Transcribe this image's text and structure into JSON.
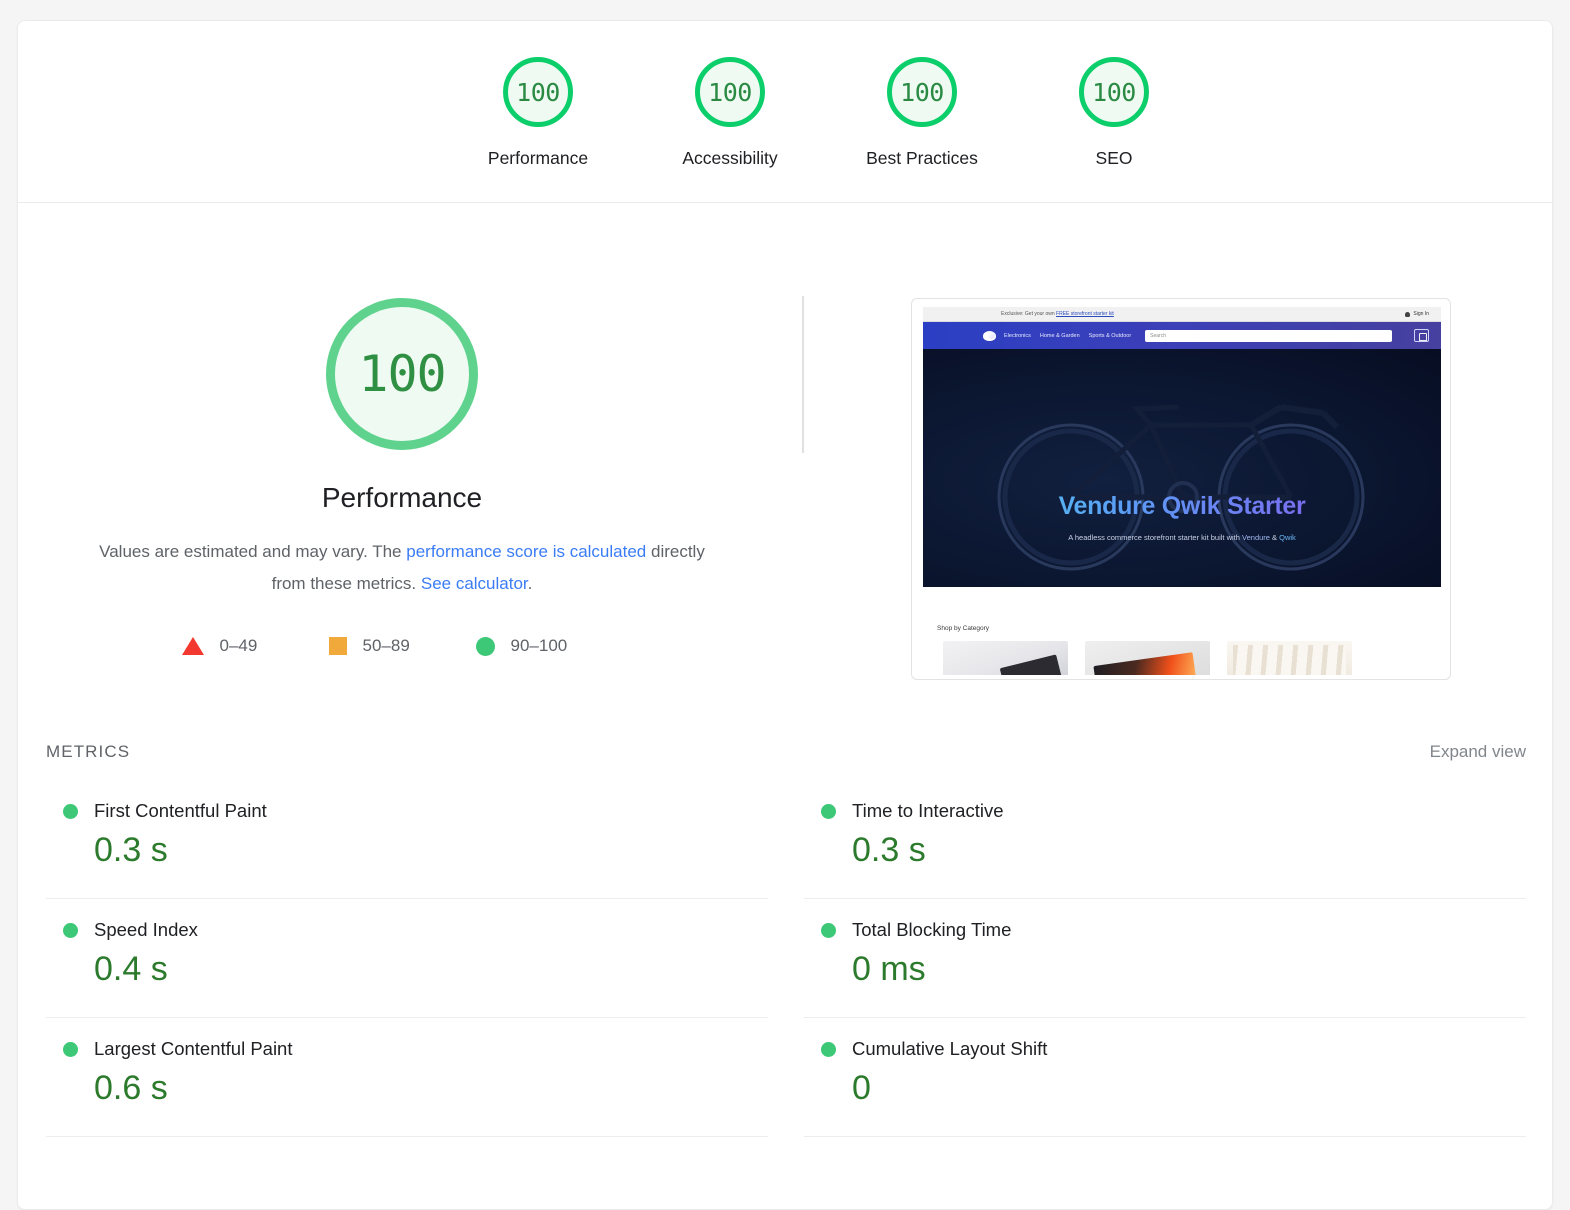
{
  "category_gauges": [
    {
      "score": "100",
      "label": "Performance"
    },
    {
      "score": "100",
      "label": "Accessibility"
    },
    {
      "score": "100",
      "label": "Best Practices"
    },
    {
      "score": "100",
      "label": "SEO"
    }
  ],
  "performance": {
    "score": "100",
    "title": "Performance",
    "description_part1": "Values are estimated and may vary. The ",
    "link1": "performance score is calculated",
    "description_part2": " directly from these metrics. ",
    "link2": "See calculator",
    "description_end": "."
  },
  "legend": [
    {
      "icon": "triangle",
      "range": "0–49",
      "color": "#f3382f"
    },
    {
      "icon": "square",
      "range": "50–89",
      "color": "#f2a93b"
    },
    {
      "icon": "circle",
      "range": "90–100",
      "color": "#3dc877"
    }
  ],
  "thumbnail": {
    "banner": "Exclusive: Get your own ",
    "banner_link": "FREE storefront starter kit",
    "sign_in": "Sign In",
    "nav": [
      "Electronics",
      "Home & Garden",
      "Sports & Outdoor"
    ],
    "search_placeholder": "Search",
    "hero_title": "Vendure Qwik Starter",
    "hero_sub_a": "A headless commerce storefront starter kit built with ",
    "hero_sub_b": "Vendure",
    "hero_sub_c": " & ",
    "hero_sub_d": "Qwik",
    "shop_by_category": "Shop by Category"
  },
  "metrics": {
    "section_title": "METRICS",
    "expand_view": "Expand view",
    "left_column": [
      {
        "name": "First Contentful Paint",
        "value": "0.3 s",
        "status": "pass"
      },
      {
        "name": "Speed Index",
        "value": "0.4 s",
        "status": "pass"
      },
      {
        "name": "Largest Contentful Paint",
        "value": "0.6 s",
        "status": "pass"
      }
    ],
    "right_column": [
      {
        "name": "Time to Interactive",
        "value": "0.3 s",
        "status": "pass"
      },
      {
        "name": "Total Blocking Time",
        "value": "0 ms",
        "status": "pass"
      },
      {
        "name": "Cumulative Layout Shift",
        "value": "0",
        "status": "pass"
      }
    ]
  },
  "colors": {
    "pass_green": "#0cce6b",
    "pass_dot": "#3dc877",
    "value_green": "#2c7a2c",
    "average_orange": "#f2a93b",
    "fail_red": "#f3382f",
    "link_blue": "#3b7cf6"
  }
}
